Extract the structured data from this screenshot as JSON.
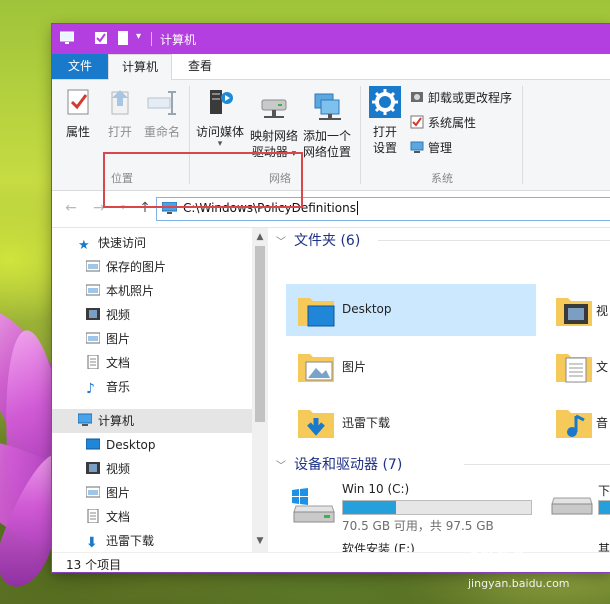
{
  "window": {
    "title": "计算机"
  },
  "tabs": [
    {
      "label": "文件"
    },
    {
      "label": "计算机"
    },
    {
      "label": "查看"
    }
  ],
  "ribbon": {
    "location_group": {
      "label": "位置",
      "buttons": [
        {
          "label": "属性"
        },
        {
          "label": "打开"
        },
        {
          "label": "重命名"
        }
      ]
    },
    "network_group": {
      "label": "网络",
      "buttons": [
        {
          "label": "访问媒体"
        },
        {
          "label_line1": "映射网络",
          "label_line2": "驱动器"
        },
        {
          "label_line1": "添加一个",
          "label_line2": "网络位置"
        }
      ]
    },
    "system_group": {
      "label": "系统",
      "open_settings": {
        "label_line1": "打开",
        "label_line2": "设置"
      },
      "small_buttons": [
        {
          "label": "卸载或更改程序"
        },
        {
          "label": "系统属性"
        },
        {
          "label": "管理"
        }
      ]
    }
  },
  "address": {
    "path": "C:\\Windows\\PolicyDefinitions"
  },
  "nav": {
    "items": [
      {
        "label": "快速访问",
        "icon": "star-icon"
      },
      {
        "label": "保存的图片",
        "icon": "pictures-folder-icon"
      },
      {
        "label": "本机照片",
        "icon": "pictures-folder-icon"
      },
      {
        "label": "视频",
        "icon": "video-folder-icon"
      },
      {
        "label": "图片",
        "icon": "pictures-folder-icon"
      },
      {
        "label": "文档",
        "icon": "document-folder-icon"
      },
      {
        "label": "音乐",
        "icon": "music-note-icon"
      },
      {
        "label": "计算机",
        "icon": "computer-icon"
      },
      {
        "label": "Desktop",
        "icon": "desktop-icon"
      },
      {
        "label": "视频",
        "icon": "video-folder-icon"
      },
      {
        "label": "图片",
        "icon": "pictures-folder-icon"
      },
      {
        "label": "文档",
        "icon": "document-folder-icon"
      },
      {
        "label": "迅雷下载",
        "icon": "download-arrow-icon"
      }
    ]
  },
  "content": {
    "folders_header": "文件夹 (6)",
    "folders": [
      {
        "label": "Desktop"
      },
      {
        "label": "视"
      },
      {
        "label": "图片"
      },
      {
        "label": "文"
      },
      {
        "label": "迅雷下载"
      },
      {
        "label": "音"
      }
    ],
    "devices_header": "设备和驱动器 (7)",
    "drives": [
      {
        "name": "Win 10 (C:)",
        "info": "70.5 GB 可用，共 97.5 GB",
        "used_fraction": 0.28
      },
      {
        "name": "下"
      },
      {
        "name": "软件安装 (E:)"
      },
      {
        "name": "其"
      }
    ]
  },
  "status": {
    "item_count": "13 个项目"
  },
  "colors": {
    "titlebar": "#b43fe0",
    "file_tab": "#1979ca",
    "highlight_box": "#d9474a",
    "drive_bar": "#26a0da",
    "section_header": "#1e3287",
    "selected_tile": "#cce8ff"
  },
  "watermark": {
    "brand": "Bai 经验",
    "url": "jingyan.baidu.com"
  }
}
